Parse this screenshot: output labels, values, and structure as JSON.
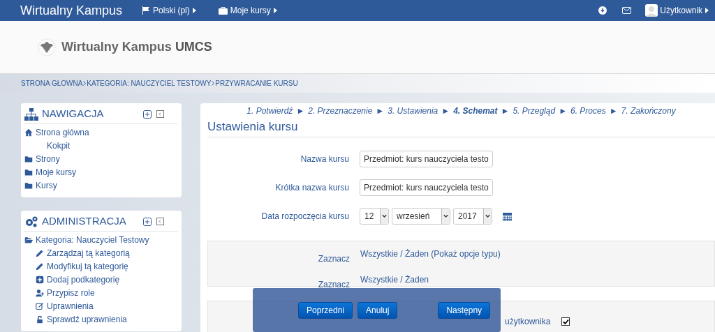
{
  "navbar": {
    "brand": "Wirtualny Kampus",
    "menus": [
      {
        "kind": "flag",
        "label": "Polski (pl)"
      },
      {
        "kind": "briefcase",
        "label": "Moje kursy"
      }
    ],
    "user": "Użytkownik"
  },
  "header": {
    "logo_text": "Wirtualny Kampus ",
    "logo_bold": "UMCS"
  },
  "breadcrumb": [
    "STRONA GŁOWNA",
    "KATEGORIA: NAUCZYCIEL TESTOWY",
    "PRZYWRACANIE KURSU"
  ],
  "blocks": [
    {
      "kind": "nav",
      "title": "NAWIGACJA",
      "items": [
        {
          "label": "Strona główna",
          "children": [
            {
              "label": "Kokpit"
            }
          ]
        },
        {
          "label": "Strony"
        },
        {
          "label": "Moje kursy"
        },
        {
          "label": "Kursy"
        }
      ]
    },
    {
      "kind": "admin",
      "title": "ADMINISTRACJA",
      "items": [
        {
          "label": "Kategoria: Nauczyciel Testowy",
          "children": [
            {
              "label": "Zarządzaj tą kategorią"
            },
            {
              "label": "Modyfikuj tą kategorię"
            },
            {
              "label": "Dodaj podkategorię"
            },
            {
              "label": "Przypisz role"
            },
            {
              "label": "Uprawnienia"
            },
            {
              "label": "Sprawdź uprawnienia"
            }
          ]
        }
      ]
    }
  ],
  "steps": [
    {
      "label": "1. Potwierdź",
      "selected": false
    },
    {
      "label": "2. Przeznaczenie",
      "selected": false
    },
    {
      "label": "3. Ustawienia",
      "selected": false
    },
    {
      "label": "4. Schemat",
      "selected": true
    },
    {
      "label": "5. Przegląd",
      "selected": false
    },
    {
      "label": "6. Proces",
      "selected": false
    },
    {
      "label": "7. Zakończony",
      "selected": false
    }
  ],
  "step_separator": "►",
  "heading": "Ustawienia kursu",
  "fields": [
    {
      "kind": "text",
      "label": "Nazwa kursu",
      "value": "Przedmiot: kurs nauczyciela testo"
    },
    {
      "kind": "text",
      "label": "Krótka nazwa kursu",
      "value": "Przedmiot: kurs nauczyciela testo"
    },
    {
      "kind": "date",
      "label": "Data rozpoczęcia kursu",
      "day": "12",
      "month": "wrzesień",
      "year": "2017"
    }
  ],
  "select_rows": [
    {
      "label": "Zaznacz",
      "value": "Wszystkie / Żaden (Pokaż opcje typu)"
    },
    {
      "label": "Zaznacz",
      "value": "Wszystkie / Żaden"
    }
  ],
  "user_row": {
    "label": "użytkownika",
    "checked": true
  },
  "buttons": [
    {
      "label": "Poprzedni"
    },
    {
      "label": "Anuluj"
    },
    {
      "label": "Następny"
    }
  ]
}
